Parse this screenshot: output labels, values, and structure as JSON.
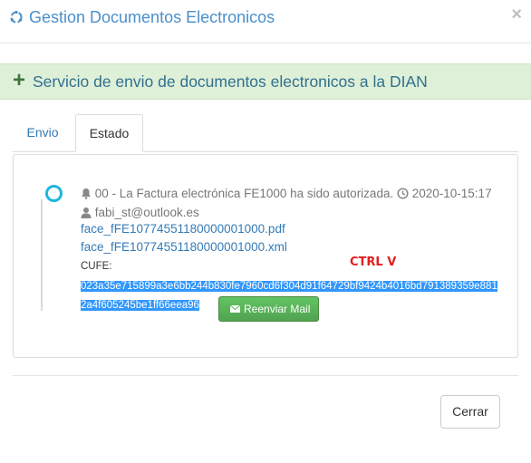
{
  "modal": {
    "title": "Gestion Documentos Electronicos",
    "close_glyph": "×"
  },
  "banner": {
    "icon": "plus-icon",
    "plus": "+",
    "text": "Servicio de envio de documentos electronicos a la DIAN"
  },
  "tabs": [
    {
      "label": "Envio",
      "active": false
    },
    {
      "label": "Estado",
      "active": true
    }
  ],
  "event": {
    "message": "00 - La Factura electrónica FE1000  ha sido autorizada.",
    "timestamp": "2020-10-15:17",
    "email": "fabi_st@outlook.es",
    "files": [
      "face_fFE10774551180000001000.pdf",
      "face_fFE10774551180000001000.xml"
    ],
    "cufe_label": "CUFE:",
    "cufe_value": "023a35e715899a3e6bb244b830fe7960cd6f304d91f64729bf9424b4016bd791389359e8812a4f605245be1ff66eea96",
    "resend_label": "Reenviar Mail"
  },
  "annotation": "CTRL V",
  "footer": {
    "close_label": "Cerrar"
  },
  "colors": {
    "accent": "#4a8fca",
    "timeline_dot": "#1fb6dc",
    "banner_bg": "#dff0d8",
    "selection": "#3297fd",
    "resend_button": "#5cb85c",
    "annotation": "#e02020"
  }
}
